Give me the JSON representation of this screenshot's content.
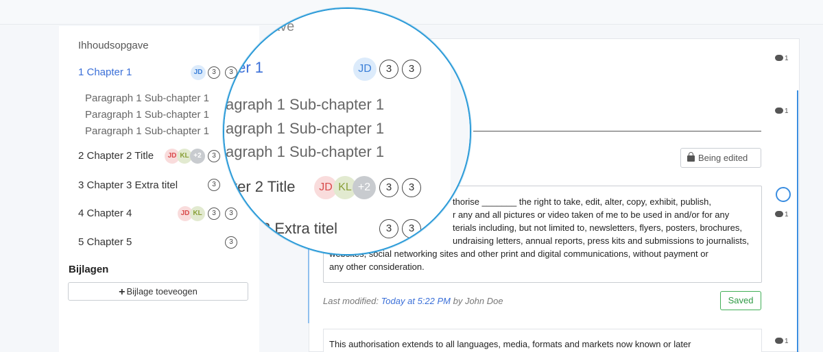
{
  "sidebar": {
    "title": "Ihhoudsopgave",
    "chapters": [
      {
        "label": "1 Chapter 1",
        "avatars": [
          "JD"
        ],
        "comment_count": "3",
        "count": "3"
      },
      {
        "label": "2 Chapter 2 Title",
        "avatars": [
          "JD",
          "KL",
          "+2"
        ],
        "comment_count": "3",
        "count": "3"
      },
      {
        "label": "3 Chapter 3 Extra titel",
        "comment_count": "3",
        "count": "3"
      },
      {
        "label": "4 Chapter 4",
        "avatars": [
          "JD",
          "KL"
        ],
        "comment_count": "3",
        "count": "3"
      },
      {
        "label": "5 Chapter 5",
        "count": "3"
      }
    ],
    "subchapters": [
      "Paragraph 1 Sub-chapter 1",
      "Paragraph 1 Sub-chapter 1",
      "Paragraph 1 Sub-chapter 1"
    ],
    "attachments_heading": "Bijlagen",
    "add_attachment_label": "Bijlage toeveogen"
  },
  "magnifier": {
    "heading_fragment": "ave",
    "chapter1": "ter 1",
    "sub1": "agraph 1 Sub-chapter 1",
    "sub2": "agraph 1 Sub-chapter 1",
    "sub3": "agraph 1 Sub-chapter 1",
    "chapter2": "ter 2 Title",
    "chapter3": "3 Extra titel"
  },
  "main": {
    "being_edited_label": "Being edited",
    "paragraph_lines": [
      "thorise _______  the right to take, edit, alter, copy, exhibit, publish,",
      "r any and all pictures or video taken of me to be used in and/or for any",
      "terials including, but not limited to, newsletters, flyers, posters, brochures,",
      "undraising letters, annual reports, press kits and submissions to journalists,",
      "websites, social networking sites and other print and digital communications, without payment or",
      "any other consideration."
    ],
    "modified_prefix": "Last modified:",
    "modified_time": "Today at 5:22 PM",
    "modified_suffix": "by John Doe",
    "saved_label": "Saved",
    "paragraph2": "This authorisation extends to all languages, media, formats and markets now known or later"
  },
  "comments": {
    "c1": "1",
    "c2": "1",
    "c3": "1",
    "c4": "1"
  },
  "colors": {
    "accent": "#3a6fd8",
    "saved": "#2e9a44",
    "magnifier_border": "#2a9ad8"
  }
}
